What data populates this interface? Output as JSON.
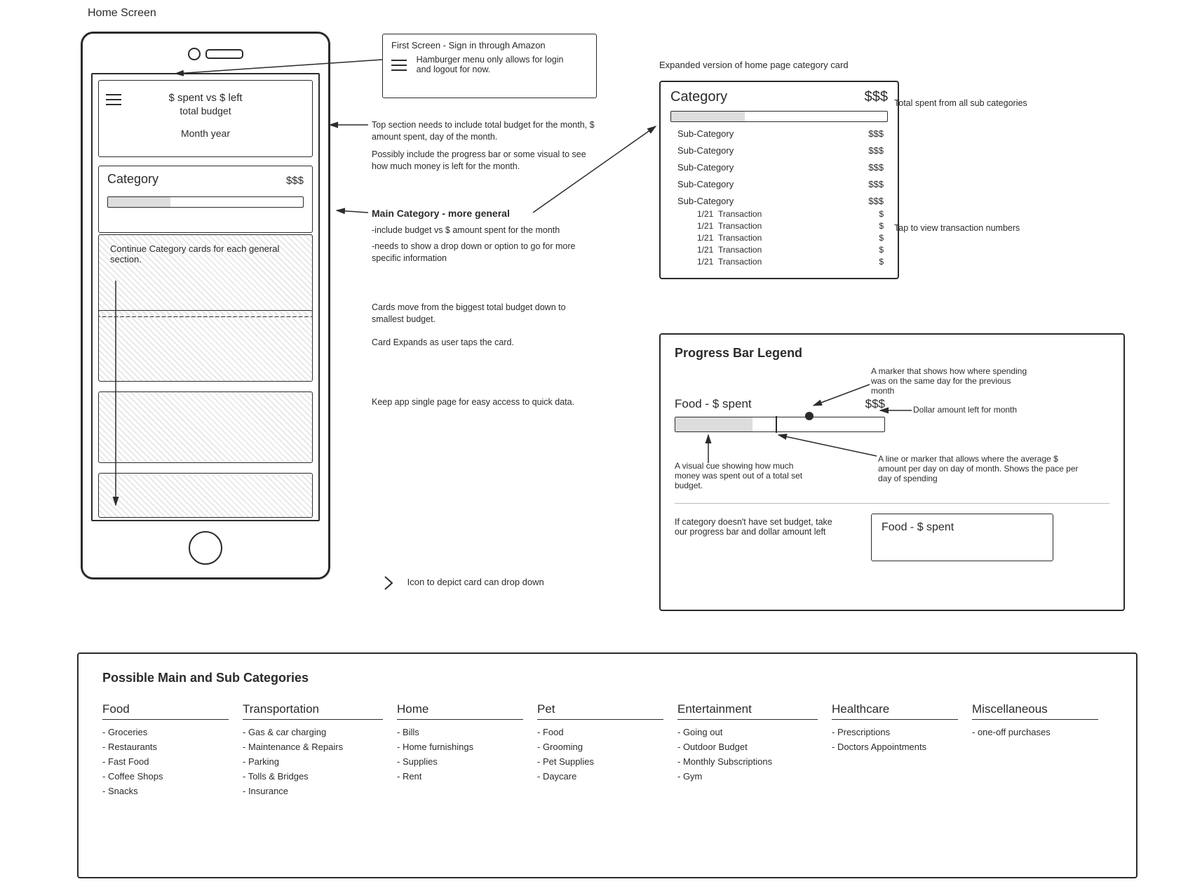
{
  "page_title": "Home Screen",
  "phone": {
    "top_line1": "$ spent vs $ left",
    "top_line2": "total budget",
    "top_line3": "Month year",
    "category_label": "Category",
    "category_amount": "$$$",
    "continue_note": "Continue Category cards for each general section."
  },
  "callout": {
    "line1": "First Screen - Sign in through Amazon",
    "line2": "Hamburger menu only allows for login and logout for now."
  },
  "annotations": {
    "top_a": "Top section needs to include total budget for the month, $ amount spent, day of the month.",
    "top_b": "Possibly include the progress bar or some visual to see how much money is left for the month.",
    "main_header": "Main Category - more general",
    "main_a": "-include budget vs $ amount spent for the month",
    "main_b": "-needs to show a drop down or option to go for more specific information",
    "cards_order": "Cards move from the biggest total budget down to smallest budget.",
    "cards_expand": "Card Expands as user taps the card.",
    "single_page": "Keep app single page for easy access to quick data.",
    "chev_note": "Icon to depict card can drop down"
  },
  "expanded": {
    "title": "Expanded version of home page category card",
    "header": "Category",
    "amount": "$$$",
    "side_total": "Total spent from all sub categories",
    "side_tap": "Tap to view transaction numbers",
    "subcats": [
      {
        "label": "Sub-Category",
        "amount": "$$$"
      },
      {
        "label": "Sub-Category",
        "amount": "$$$"
      },
      {
        "label": "Sub-Category",
        "amount": "$$$"
      },
      {
        "label": "Sub-Category",
        "amount": "$$$"
      },
      {
        "label": "Sub-Category",
        "amount": "$$$"
      }
    ],
    "transactions": [
      {
        "date": "1/21",
        "label": "Transaction",
        "amount": "$"
      },
      {
        "date": "1/21",
        "label": "Transaction",
        "amount": "$"
      },
      {
        "date": "1/21",
        "label": "Transaction",
        "amount": "$"
      },
      {
        "date": "1/21",
        "label": "Transaction",
        "amount": "$"
      },
      {
        "date": "1/21",
        "label": "Transaction",
        "amount": "$"
      }
    ]
  },
  "legend": {
    "title": "Progress Bar Legend",
    "label": "Food - $ spent",
    "amount": "$$$",
    "note_marker": "A marker that shows how where spending was on the same day for the previous month",
    "note_dollar": "Dollar amount left for month",
    "note_visual": "A visual cue showing how much money was spent out of a total set budget.",
    "note_avg": "A line or marker that allows where the average $ amount per day on day of month. Shows the pace per day of spending",
    "no_budget_note": "If category doesn't have set budget, take our progress bar and dollar amount left",
    "no_budget_label": "Food - $ spent"
  },
  "categories": {
    "title": "Possible Main and Sub Categories",
    "cols": [
      {
        "name": "Food",
        "items": [
          "Groceries",
          "Restaurants",
          "Fast Food",
          "Coffee Shops",
          "Snacks"
        ]
      },
      {
        "name": "Transportation",
        "items": [
          "Gas & car charging",
          "Maintenance & Repairs",
          "Parking",
          "Tolls & Bridges",
          "Insurance"
        ]
      },
      {
        "name": "Home",
        "items": [
          "Bills",
          "Home furnishings",
          "Supplies",
          "Rent"
        ]
      },
      {
        "name": "Pet",
        "items": [
          "Food",
          "Grooming",
          "Pet Supplies",
          "Daycare"
        ]
      },
      {
        "name": "Entertainment",
        "items": [
          "Going out",
          "Outdoor Budget",
          "Monthly Subscriptions",
          "Gym"
        ]
      },
      {
        "name": "Healthcare",
        "items": [
          "Prescriptions",
          "Doctors Appointments"
        ]
      },
      {
        "name": "Miscellaneous",
        "items": [
          "one-off purchases"
        ]
      }
    ]
  }
}
